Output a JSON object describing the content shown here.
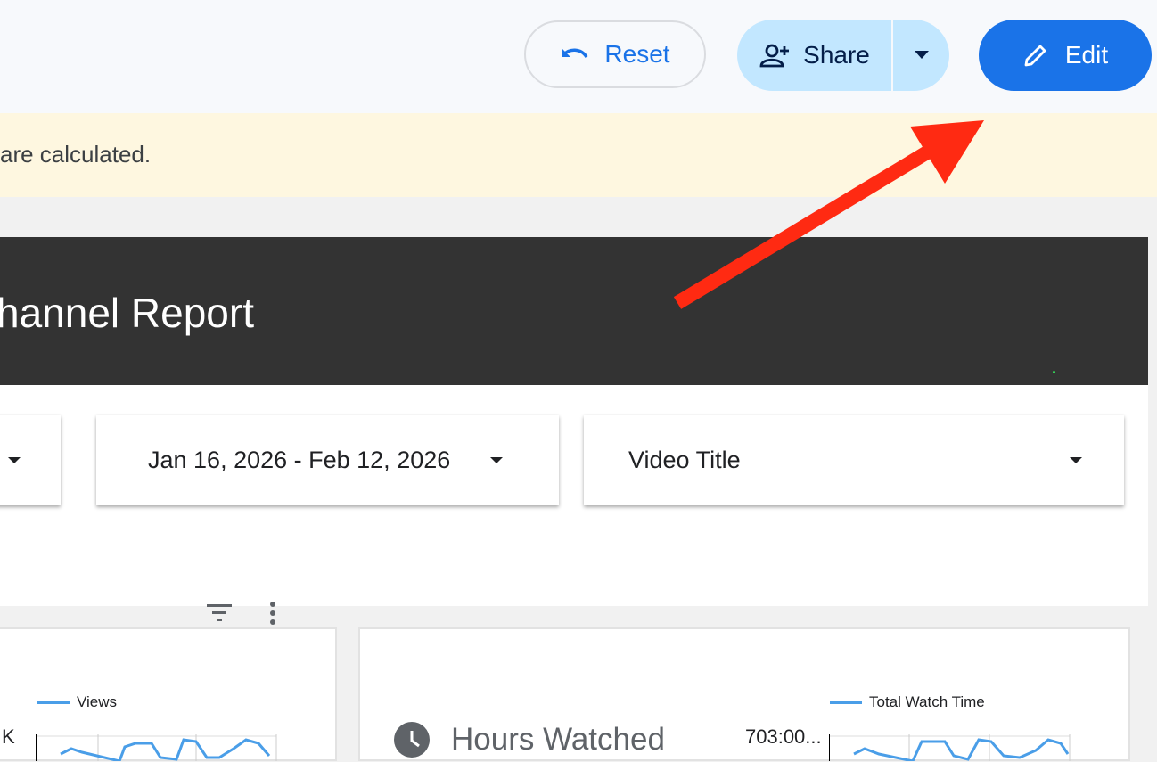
{
  "toolbar": {
    "reset_label": "Reset",
    "share_label": "Share",
    "edit_label": "Edit"
  },
  "banner": {
    "text": "are calculated."
  },
  "report": {
    "title": "hannel Report"
  },
  "controls": {
    "date_range": "Jan 16, 2026 - Feb 12, 2026",
    "dimension": "Video Title"
  },
  "charts": [
    {
      "legend": "Views",
      "axis_tick": "K"
    },
    {
      "legend": "Total Watch Time",
      "metric_title": "Hours Watched",
      "axis_tick": "703:00..."
    }
  ],
  "colors": {
    "accent": "#1a73e8",
    "share_bg": "#c2e7ff",
    "banner_bg": "#fef7e0",
    "header_bg": "#333333",
    "series": "#4a9ee8",
    "arrow": "#ff2a12"
  },
  "icons": {
    "reset": "undo-icon",
    "share": "add-person-icon",
    "edit": "pencil-icon",
    "filter": "filter-icon",
    "more": "more-vert-icon",
    "clock": "clock-icon"
  }
}
